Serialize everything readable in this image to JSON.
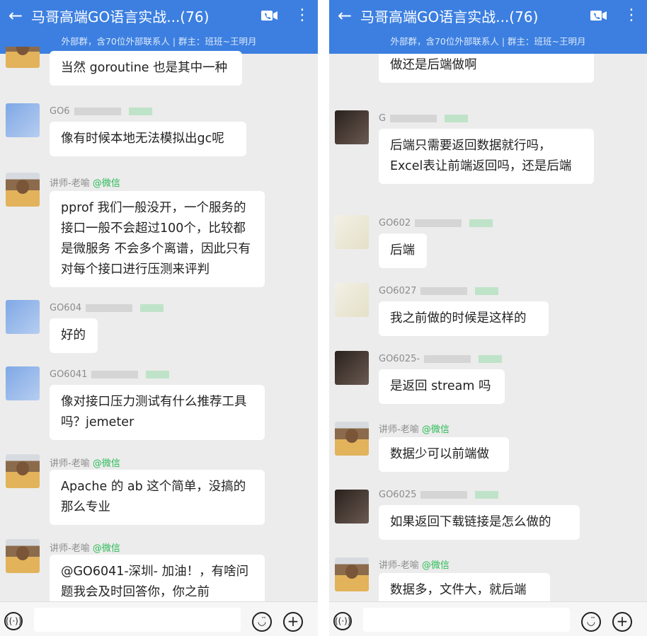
{
  "left": {
    "header": {
      "title": "马哥高端GO语言实战...(76)",
      "subtitle": "外部群，含70位外部联系人 | 群主：班班~王明月"
    },
    "messages": [
      {
        "avatar": "teacher",
        "sender": "",
        "text": "当然 goroutine 也是其中一种"
      },
      {
        "avatar": "blue",
        "sender": "GO6",
        "tag": "",
        "text": "像有时候本地无法模拟出gc呢"
      },
      {
        "avatar": "teacher",
        "sender": "讲师-老喻",
        "tag": "@微信",
        "text": "pprof 我们一般没开，一个服务的接口一般不会超过100个，比较都是微服务 不会多个离谱，因此只有 对每个接口进行压测来评判"
      },
      {
        "avatar": "blue",
        "sender": "GO604",
        "tag": "",
        "text": "好的"
      },
      {
        "avatar": "blue",
        "sender": "GO6041",
        "tag": "",
        "text": "像对接口压力测试有什么推荐工具吗？jemeter"
      },
      {
        "avatar": "teacher",
        "sender": "讲师-老喻",
        "tag": "@微信",
        "text": "Apache 的 ab 这个简单，没搞的那么专业"
      },
      {
        "avatar": "teacher",
        "sender": "讲师-老喻",
        "tag": "@微信",
        "text": "@GO6041-深圳-  加油！，有啥问题我会及时回答你，你之前"
      }
    ]
  },
  "right": {
    "header": {
      "title": "马哥高端GO语言实战...(76)",
      "subtitle": "外部群，含70位外部联系人 | 群主：班班~王明月"
    },
    "messages": [
      {
        "avatar": "",
        "sender": "",
        "text": "做还是后端做啊"
      },
      {
        "avatar": "dark",
        "sender": "G",
        "tag": "",
        "text": "后端只需要返回数据就行吗，Excel表让前端返回吗，还是后端"
      },
      {
        "avatar": "light",
        "sender": "GO602",
        "tag": "",
        "text": "后端"
      },
      {
        "avatar": "light",
        "sender": "GO6027",
        "tag": "",
        "text": "我之前做的时候是这样的"
      },
      {
        "avatar": "dark",
        "sender": "GO6025-",
        "tag": "",
        "text": "是返回 stream 吗"
      },
      {
        "avatar": "teacher",
        "sender": "讲师-老喻",
        "tag": "@微信",
        "text": "数据少可以前端做"
      },
      {
        "avatar": "dark",
        "sender": "GO6025",
        "tag": "",
        "text": "如果返回下载链接是怎么做的"
      },
      {
        "avatar": "teacher",
        "sender": "讲师-老喻",
        "tag": "@微信",
        "text": "数据多，文件大，就后端"
      }
    ]
  },
  "icons": {
    "back": "back-arrow-icon",
    "video": "video-call-icon",
    "more": "more-vertical-icon",
    "voice": "voice-icon",
    "emoji": "emoji-icon",
    "plus": "plus-icon"
  },
  "colors": {
    "header": "#3c7fe0",
    "tag": "#2bbb57",
    "chat_bg": "#ececec"
  }
}
